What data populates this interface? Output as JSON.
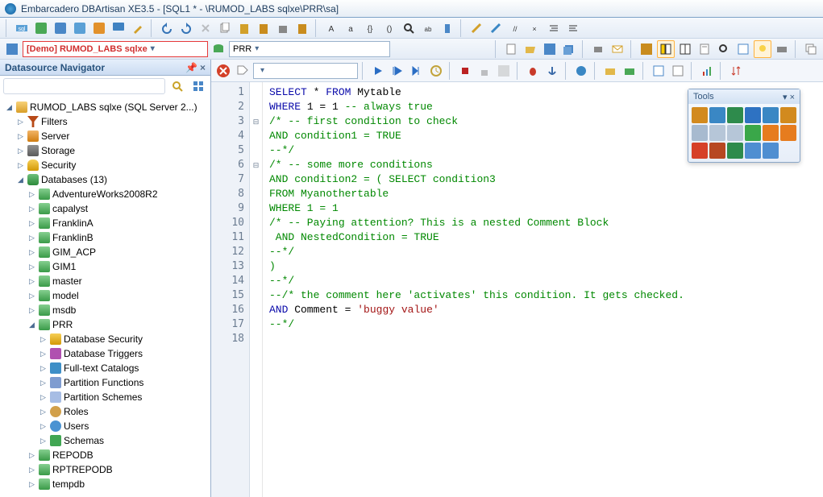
{
  "window": {
    "title": "Embarcadero DBArtisan XE3.5 - [SQL1 * - \\RUMOD_LABS sqlxe\\PRR\\sa]"
  },
  "datasource_bar": {
    "demo_label": "[Demo] RUMOD_LABS sqlxe",
    "db_label": "PRR"
  },
  "navigator": {
    "title": "Datasource Navigator",
    "search_placeholder": "",
    "root": "RUMOD_LABS sqlxe (SQL Server 2...)",
    "children": {
      "filters": "Filters",
      "server": "Server",
      "storage": "Storage",
      "security": "Security",
      "databases": "Databases (13)"
    },
    "databases": [
      "AdventureWorks2008R2",
      "capalyst",
      "FranklinA",
      "FranklinB",
      "GIM_ACP",
      "GIM1",
      "master",
      "model",
      "msdb",
      "PRR",
      "REPODB",
      "RPTREPODB",
      "tempdb"
    ],
    "prr_children": {
      "dbsec": "Database Security",
      "trig": "Database Triggers",
      "ftc": "Full-text Catalogs",
      "pfun": "Partition Functions",
      "psch": "Partition Schemes",
      "roles": "Roles",
      "users": "Users",
      "schemas": "Schemas"
    }
  },
  "editor": {
    "lines": [
      {
        "n": "1",
        "segs": [
          {
            "t": "SELECT",
            "c": "kw"
          },
          {
            "t": " * ",
            "c": ""
          },
          {
            "t": "FROM",
            "c": "kw"
          },
          {
            "t": " Mytable",
            "c": ""
          }
        ]
      },
      {
        "n": "2",
        "segs": [
          {
            "t": "WHERE",
            "c": "kw"
          },
          {
            "t": " 1 = 1 ",
            "c": ""
          },
          {
            "t": "-- always true",
            "c": "cm"
          }
        ]
      },
      {
        "n": "3",
        "segs": [
          {
            "t": "/* -- first condition to check",
            "c": "cm"
          }
        ]
      },
      {
        "n": "4",
        "segs": [
          {
            "t": "AND condition1 = TRUE",
            "c": "cm"
          }
        ]
      },
      {
        "n": "5",
        "segs": [
          {
            "t": "--*/",
            "c": "cm"
          }
        ]
      },
      {
        "n": "6",
        "segs": [
          {
            "t": "/* -- some more conditions",
            "c": "cm"
          }
        ]
      },
      {
        "n": "7",
        "segs": [
          {
            "t": "AND condition2 = ( SELECT condition3",
            "c": "cm"
          }
        ]
      },
      {
        "n": "8",
        "segs": [
          {
            "t": "FROM Myanothertable",
            "c": "cm"
          }
        ]
      },
      {
        "n": "9",
        "segs": [
          {
            "t": "WHERE 1 = 1",
            "c": "cm"
          }
        ]
      },
      {
        "n": "10",
        "segs": [
          {
            "t": "/* -- Paying attention? This is a nested Comment Block",
            "c": "cm"
          }
        ]
      },
      {
        "n": "11",
        "segs": [
          {
            "t": " AND NestedCondition = TRUE",
            "c": "cm"
          }
        ]
      },
      {
        "n": "12",
        "segs": [
          {
            "t": "--*/",
            "c": "cm"
          }
        ]
      },
      {
        "n": "13",
        "segs": [
          {
            "t": ")",
            "c": "cm"
          }
        ]
      },
      {
        "n": "14",
        "segs": [
          {
            "t": "--*/",
            "c": "cm"
          }
        ]
      },
      {
        "n": "15",
        "segs": [
          {
            "t": "--/* the comment here 'activates' this condition. It gets checked.",
            "c": "cm"
          }
        ]
      },
      {
        "n": "16",
        "segs": [
          {
            "t": "AND",
            "c": "kw"
          },
          {
            "t": " Comment ",
            "c": ""
          },
          {
            "t": "=",
            "c": "sym"
          },
          {
            "t": " ",
            "c": ""
          },
          {
            "t": "'buggy value'",
            "c": "str"
          }
        ]
      },
      {
        "n": "17",
        "segs": [
          {
            "t": "--*/",
            "c": "cm"
          }
        ]
      },
      {
        "n": "18",
        "segs": [
          {
            "t": "",
            "c": ""
          }
        ]
      }
    ],
    "folds": [
      "",
      "",
      "⊟",
      "",
      "",
      "⊟",
      "",
      "",
      "",
      "",
      "",
      "",
      "",
      "",
      "",
      "",
      "",
      ""
    ]
  },
  "tools_popup": {
    "title": "Tools",
    "buttons": [
      {
        "name": "hammer-icon",
        "color": "#d28a1e"
      },
      {
        "name": "pliers-icon",
        "color": "#3a87c4"
      },
      {
        "name": "lock-server-icon",
        "color": "#2e8b4c"
      },
      {
        "name": "globe-icon",
        "color": "#2e72c2"
      },
      {
        "name": "gear-icon",
        "color": "#3a87c4"
      },
      {
        "name": "run-icon",
        "color": "#d28a1e"
      },
      {
        "name": "doc-check-icon",
        "color": "#a7bacf"
      },
      {
        "name": "clipboard-icon",
        "color": "#b6c6d8"
      },
      {
        "name": "grid-icon",
        "color": "#b6c6d8"
      },
      {
        "name": "plus-icon",
        "color": "#3aa749"
      },
      {
        "name": "orange1-icon",
        "color": "#e67c1e"
      },
      {
        "name": "orange2-icon",
        "color": "#e67c1e"
      },
      {
        "name": "record-icon",
        "color": "#d64028"
      },
      {
        "name": "tools-icon",
        "color": "#b74822"
      },
      {
        "name": "refresh-icon",
        "color": "#2e8b4c"
      },
      {
        "name": "window-icon",
        "color": "#4f8ed1"
      },
      {
        "name": "window2-icon",
        "color": "#4f8ed1"
      }
    ]
  }
}
